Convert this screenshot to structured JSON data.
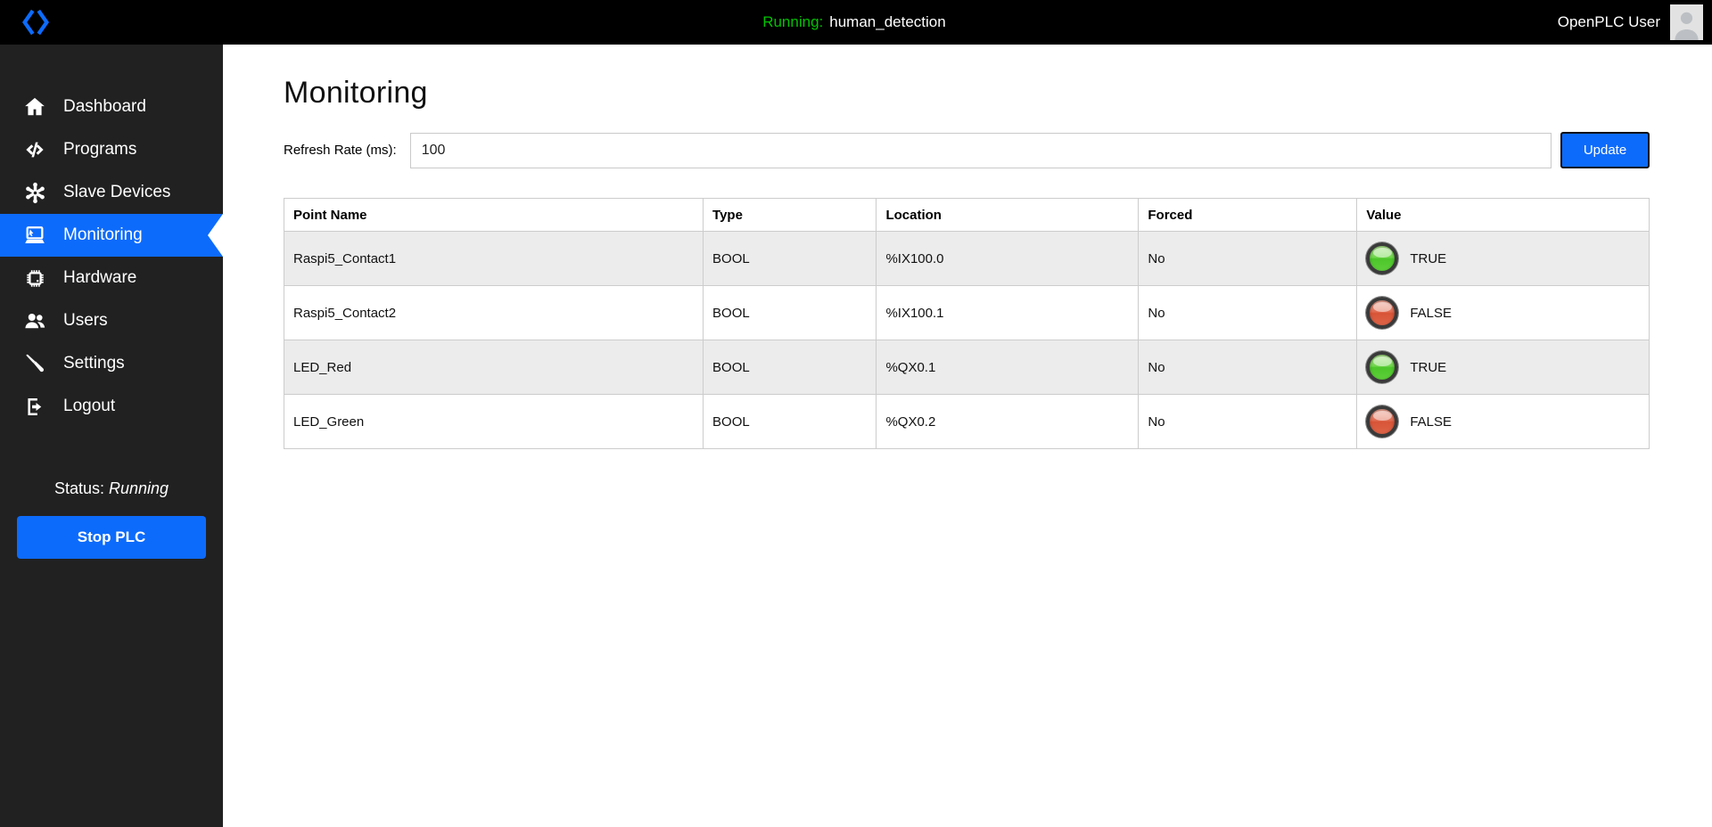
{
  "topbar": {
    "status_prefix": "Running:",
    "program_name": "human_detection",
    "user_name": "OpenPLC User"
  },
  "sidebar": {
    "items": [
      {
        "label": "Dashboard",
        "icon": "home-icon",
        "active": false
      },
      {
        "label": "Programs",
        "icon": "code-icon",
        "active": false
      },
      {
        "label": "Slave Devices",
        "icon": "slave-devices-icon",
        "active": false
      },
      {
        "label": "Monitoring",
        "icon": "monitor-icon",
        "active": true
      },
      {
        "label": "Hardware",
        "icon": "chip-icon",
        "active": false
      },
      {
        "label": "Users",
        "icon": "users-icon",
        "active": false
      },
      {
        "label": "Settings",
        "icon": "screwdriver-icon",
        "active": false
      },
      {
        "label": "Logout",
        "icon": "logout-icon",
        "active": false
      }
    ],
    "status_label": "Status:",
    "status_value": "Running",
    "stop_button_label": "Stop PLC"
  },
  "main": {
    "title": "Monitoring",
    "refresh_rate_label": "Refresh Rate (ms):",
    "refresh_rate_value": "100",
    "update_button_label": "Update"
  },
  "table": {
    "headers": [
      "Point Name",
      "Type",
      "Location",
      "Forced",
      "Value"
    ],
    "rows": [
      {
        "point_name": "Raspi5_Contact1",
        "type": "BOOL",
        "location": "%IX100.0",
        "forced": "No",
        "value": "TRUE",
        "led": "green"
      },
      {
        "point_name": "Raspi5_Contact2",
        "type": "BOOL",
        "location": "%IX100.1",
        "forced": "No",
        "value": "FALSE",
        "led": "red"
      },
      {
        "point_name": "LED_Red",
        "type": "BOOL",
        "location": "%QX0.1",
        "forced": "No",
        "value": "TRUE",
        "led": "green"
      },
      {
        "point_name": "LED_Green",
        "type": "BOOL",
        "location": "%QX0.2",
        "forced": "No",
        "value": "FALSE",
        "led": "red"
      }
    ]
  },
  "colors": {
    "accent_blue": "#0d6bfb",
    "running_green": "#00c300",
    "sidebar_bg": "#212121",
    "topbar_bg": "#000000",
    "row_alt_bg": "#ececec",
    "led_green": "#5ecf3a",
    "led_red": "#de6448"
  }
}
